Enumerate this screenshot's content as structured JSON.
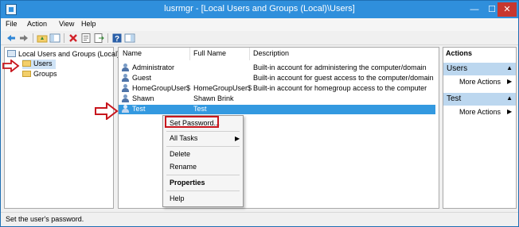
{
  "window": {
    "title": "lusrmgr - [Local Users and Groups (Local)\\Users]",
    "min_glyph": "—",
    "max_glyph": "☐",
    "close_glyph": "✕"
  },
  "menubar": {
    "items": [
      "File",
      "Action",
      "View",
      "Help"
    ]
  },
  "toolbar": {
    "icons": [
      "back-icon",
      "forward-icon",
      "up-folder-icon",
      "show-hide-tree-icon",
      "delete-icon",
      "properties-icon",
      "export-list-icon",
      "help-icon",
      "show-hide-action-pane-icon"
    ]
  },
  "tree": {
    "root": "Local Users and Groups (Local)",
    "children": [
      "Users",
      "Groups"
    ]
  },
  "list": {
    "columns": [
      "Name",
      "Full Name",
      "Description"
    ],
    "rows": [
      {
        "name": "Administrator",
        "full_name": "",
        "description": "Built-in account for administering the computer/domain"
      },
      {
        "name": "Guest",
        "full_name": "",
        "description": "Built-in account for guest access to the computer/domain"
      },
      {
        "name": "HomeGroupUser$",
        "full_name": "HomeGroupUser$",
        "description": "Built-in account for homegroup access to the computer"
      },
      {
        "name": "Shawn",
        "full_name": "Shawn Brink",
        "description": ""
      },
      {
        "name": "Test",
        "full_name": "Test",
        "description": ""
      }
    ],
    "selected_row": "Test"
  },
  "actions": {
    "header": "Actions",
    "sections": [
      {
        "title": "Users",
        "link": "More Actions"
      },
      {
        "title": "Test",
        "link": "More Actions"
      }
    ],
    "caret_glyph": "▲",
    "arrow_glyph": "▶"
  },
  "context_menu": {
    "items": [
      "Set Password...",
      "All Tasks",
      "Delete",
      "Rename",
      "Properties",
      "Help"
    ],
    "submenu_glyph": "▶"
  },
  "status_bar": {
    "text": "Set the user's password."
  },
  "colors": {
    "titlebar": "#2f8fdc",
    "selection": "#3399e0",
    "annotation_red": "#c8161d",
    "actions_section": "#bcd7ef"
  }
}
